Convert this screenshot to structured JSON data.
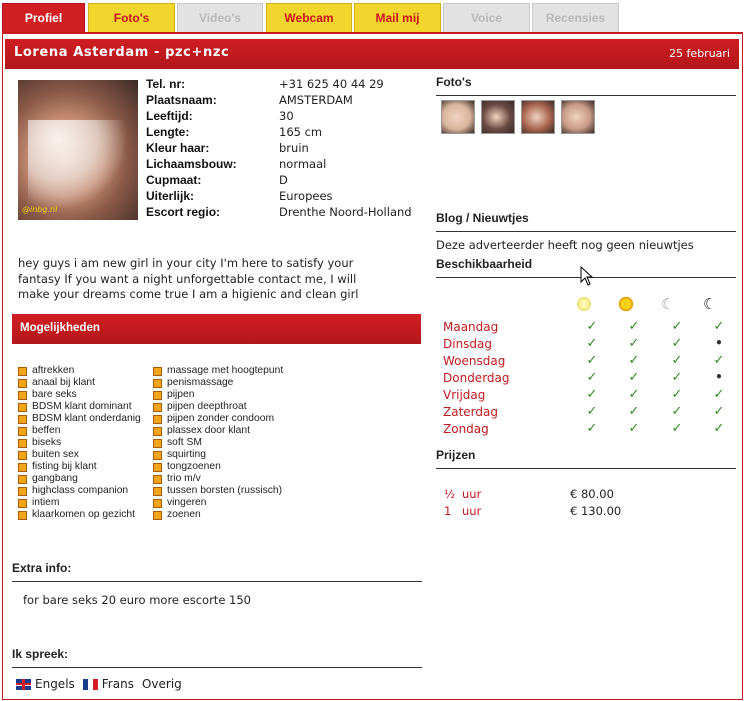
{
  "tabs": [
    {
      "label": "Profiel",
      "state": "active"
    },
    {
      "label": "Foto's",
      "state": "enabled"
    },
    {
      "label": "Video's",
      "state": "disabled"
    },
    {
      "label": "Webcam",
      "state": "enabled"
    },
    {
      "label": "Mail mij",
      "state": "enabled"
    },
    {
      "label": "Voice",
      "state": "disabled"
    },
    {
      "label": "Recensies",
      "state": "disabled"
    }
  ],
  "header": {
    "name": "Lorena Asterdam - pzc+nzc",
    "date": "25 februari"
  },
  "photo": {
    "watermark": "@inbg.nl"
  },
  "profile": [
    {
      "label": "Tel. nr:",
      "value": "+31 625 40 44 29"
    },
    {
      "label": "Plaatsnaam:",
      "value": "AMSTERDAM"
    },
    {
      "label": "Leeftijd:",
      "value": "30"
    },
    {
      "label": "Lengte:",
      "value": "165 cm"
    },
    {
      "label": "Kleur haar:",
      "value": "bruin"
    },
    {
      "label": "Lichaamsbouw:",
      "value": "normaal"
    },
    {
      "label": "Cupmaat:",
      "value": "D"
    },
    {
      "label": "Uiterlijk:",
      "value": "Europees"
    },
    {
      "label": "Escort regio:",
      "value": "Drenthe Noord-Holland"
    }
  ],
  "bio": "hey guys i am new girl in your city I'm here to satisfy your fantasy If you want a night unforgettable contact me, I will make your dreams come true I am a higienic and clean girl",
  "mogelijkheden": {
    "title": "Mogelijkheden",
    "col1": [
      "aftrekken",
      "anaal bij klant",
      "bare seks",
      "BDSM klant dominant",
      "BDSM klant onderdanig",
      "beffen",
      "biseks",
      "buiten sex",
      "fisting bij klant",
      "gangbang",
      "highclass companion",
      "intiem",
      "klaarkomen op gezicht"
    ],
    "col2": [
      "massage met hoogtepunt",
      "penismassage",
      "pijpen",
      "pijpen deepthroat",
      "pijpen zonder condoom",
      "plassex door klant",
      "soft SM",
      "squirting",
      "tongzoenen",
      "trio m/v",
      "tussen borsten (russisch)",
      "vingeren",
      "zoenen"
    ]
  },
  "extra": {
    "title": "Extra info:",
    "text": "for bare seks 20 euro more escorte 150"
  },
  "languages": {
    "title": "Ik spreek:",
    "items": [
      "Engels",
      "Frans",
      "Overig"
    ]
  },
  "fotos": {
    "title": "Foto's",
    "thumb_colors": [
      "#d9b59c",
      "#6b4a44",
      "#a8654f",
      "#c79a86"
    ]
  },
  "blog": {
    "title": "Blog / Nieuwtjes",
    "text": "Deze adverteerder heeft nog geen nieuwtjes"
  },
  "availability": {
    "title": "Beschikbaarheid",
    "periods": [
      "morning-sun-icon",
      "afternoon-sun-icon",
      "evening-moon-icon",
      "night-moon-icon"
    ],
    "days": [
      {
        "day": "Maandag",
        "slots": [
          true,
          true,
          true,
          true
        ]
      },
      {
        "day": "Dinsdag",
        "slots": [
          true,
          true,
          true,
          false
        ]
      },
      {
        "day": "Woensdag",
        "slots": [
          true,
          true,
          true,
          true
        ]
      },
      {
        "day": "Donderdag",
        "slots": [
          true,
          true,
          true,
          false
        ]
      },
      {
        "day": "Vrijdag",
        "slots": [
          true,
          true,
          true,
          true
        ]
      },
      {
        "day": "Zaterdag",
        "slots": [
          true,
          true,
          true,
          true
        ]
      },
      {
        "day": "Zondag",
        "slots": [
          true,
          true,
          true,
          true
        ]
      }
    ]
  },
  "prices": {
    "title": "Prijzen",
    "rows": [
      {
        "qty": "½",
        "unit": "uur",
        "price": "€ 80.00"
      },
      {
        "qty": "1",
        "unit": "uur",
        "price": "€ 130.00"
      }
    ]
  },
  "colors": {
    "brand_red": "#d11f23",
    "tab_yellow": "#f2d62e",
    "ok_green": "#2e8b22"
  }
}
